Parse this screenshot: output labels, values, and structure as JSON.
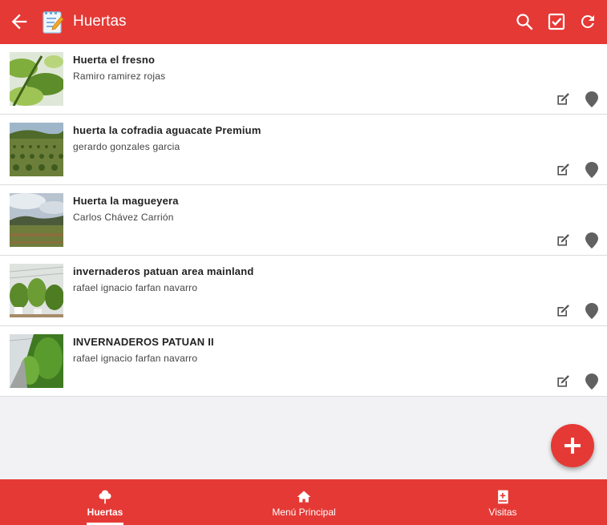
{
  "header": {
    "title": "Huertas"
  },
  "huertas": [
    {
      "title": "Huerta el fresno",
      "owner": "Ramiro ramirez rojas"
    },
    {
      "title": "huerta la cofradia aguacate Premium",
      "owner": "gerardo gonzales garcia"
    },
    {
      "title": "Huerta la magueyera",
      "owner": "Carlos Chávez Carrión"
    },
    {
      "title": "invernaderos patuan area mainland",
      "owner": "rafael ignacio farfan navarro"
    },
    {
      "title": "INVERNADEROS PATUAN II",
      "owner": "rafael ignacio farfan navarro"
    }
  ],
  "bottom_nav": [
    {
      "label": "Huertas",
      "icon": "tree-icon",
      "active": true
    },
    {
      "label": "Menú Principal",
      "icon": "home-icon",
      "active": false
    },
    {
      "label": "Visitas",
      "icon": "book-icon",
      "active": false
    }
  ],
  "colors": {
    "primary": "#e53935"
  }
}
